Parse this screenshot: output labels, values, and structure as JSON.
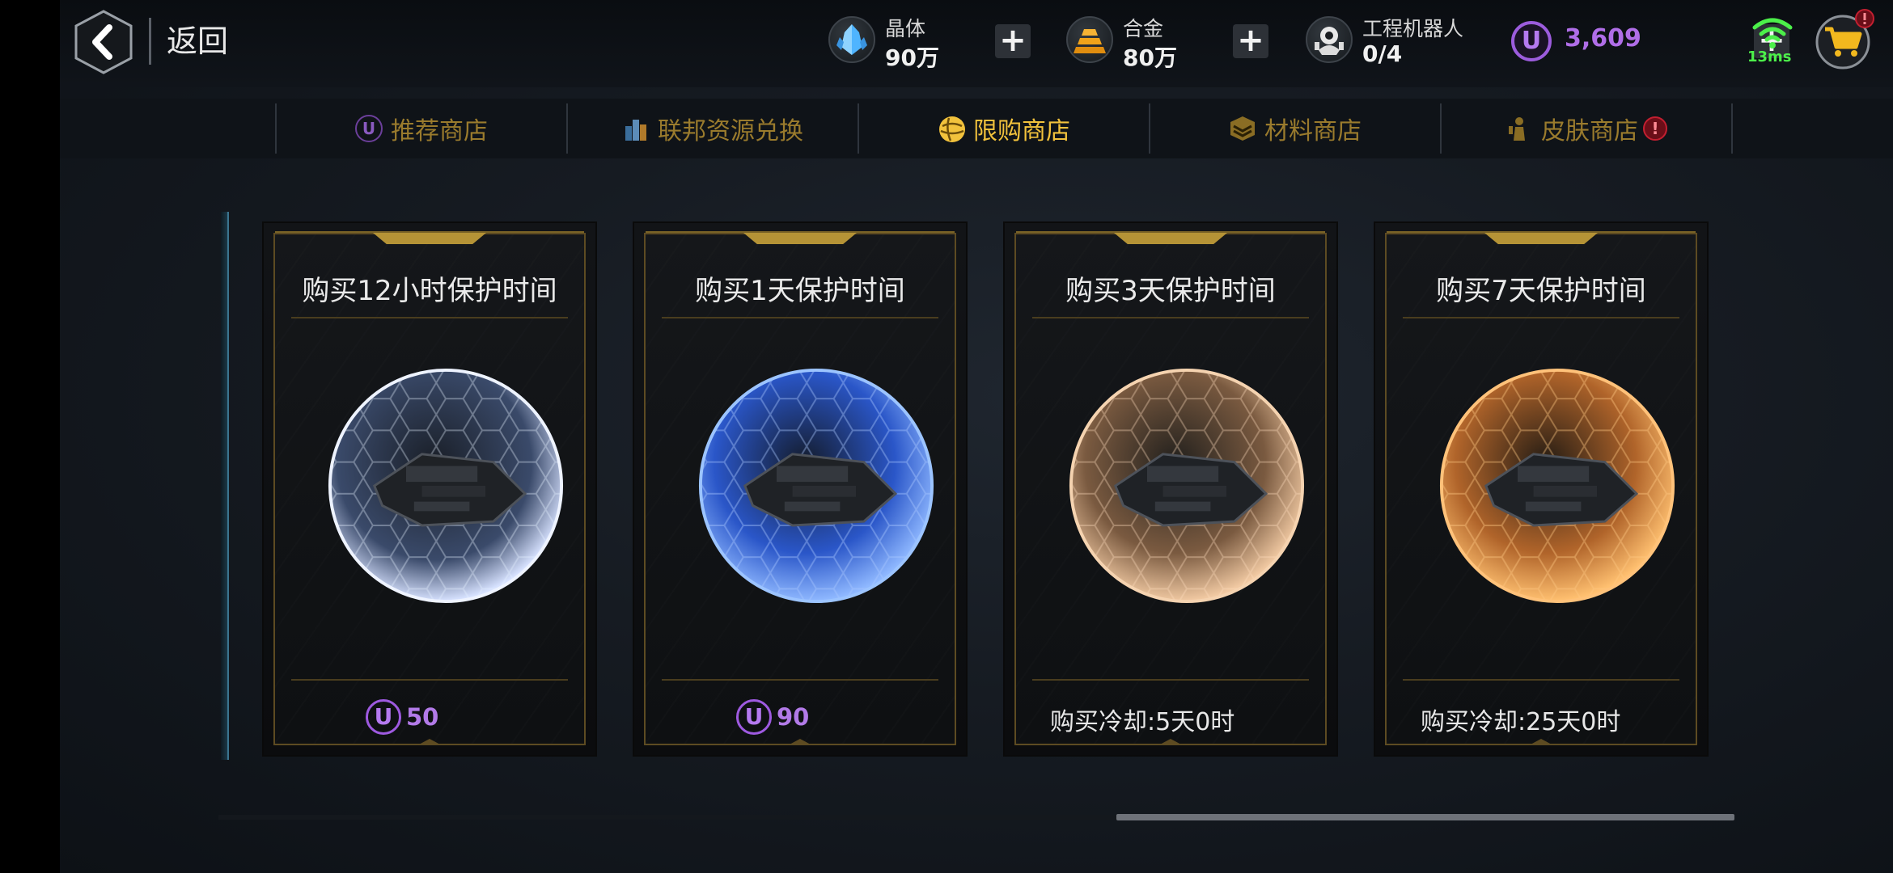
{
  "topbar": {
    "back_label": "返回",
    "resources": [
      {
        "name": "晶体",
        "value": "90万",
        "icon": "crystal-icon",
        "color": "#5bb8ff"
      },
      {
        "name": "合金",
        "value": "80万",
        "icon": "alloy-icon",
        "color": "#f0a21a"
      },
      {
        "name": "工程机器人",
        "value": "0/4",
        "icon": "robot-icon",
        "color": "#e0e0e0"
      }
    ],
    "plus_label": "+",
    "currency": {
      "icon": "u-coin-icon",
      "value": "3,609",
      "color": "#b06ee8"
    },
    "ping": "13ms",
    "cart_icon": "cart-icon",
    "cart_badge_icon": "notification-badge-icon"
  },
  "tabs": [
    {
      "label": "推荐商店",
      "icon": "u-coin-icon",
      "active": false
    },
    {
      "label": "联邦资源兑换",
      "icon": "buildings-icon",
      "active": false
    },
    {
      "label": "限购商店",
      "icon": "limited-globe-icon",
      "active": true
    },
    {
      "label": "材料商店",
      "icon": "material-crate-icon",
      "active": false
    },
    {
      "label": "皮肤商店",
      "icon": "skin-figure-icon",
      "active": false,
      "badge": "!"
    }
  ],
  "cards": [
    {
      "title": "购买12小时保护时间",
      "shield": "silver-blue",
      "price_icon": "U",
      "price": "50"
    },
    {
      "title": "购买1天保护时间",
      "shield": "blue",
      "price_icon": "U",
      "price": "90"
    },
    {
      "title": "购买3天保护时间",
      "shield": "bronze",
      "cooldown": "购买冷却:5天0时"
    },
    {
      "title": "购买7天保护时间",
      "shield": "orange-gold",
      "cooldown": "购买冷却:25天0时"
    }
  ],
  "colors": {
    "gold": "#f2c23c",
    "tab_inactive": "#9a7b2d",
    "purple": "#b06ee8"
  }
}
